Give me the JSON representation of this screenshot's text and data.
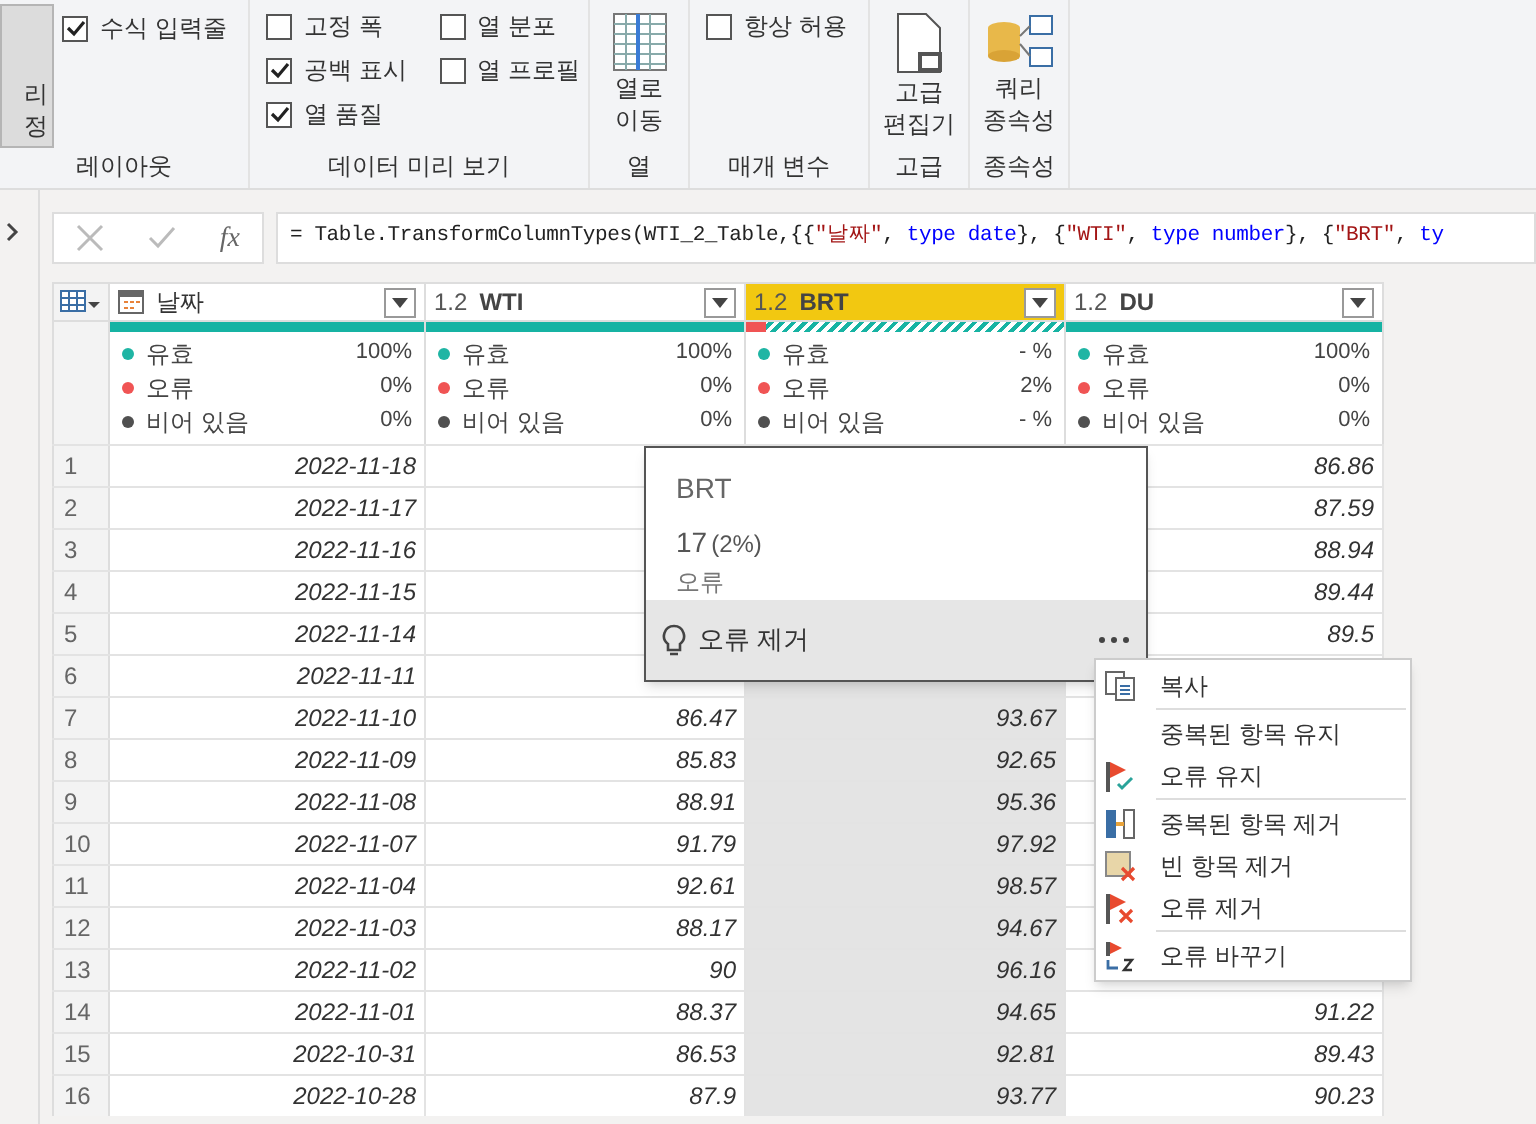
{
  "ribbon": {
    "query_settings": {
      "lines": [
        "리",
        "정"
      ],
      "selected": true
    },
    "groups": [
      {
        "label": "레이아웃",
        "kind": "checks",
        "checks": [
          {
            "label": "수식 입력줄",
            "checked": true
          }
        ]
      },
      {
        "label": "데이터 미리 보기",
        "kind": "checks",
        "checks": [
          {
            "label": "고정 폭",
            "checked": false
          },
          {
            "label": "열 분포",
            "checked": false
          },
          {
            "label": "공백 표시",
            "checked": true
          },
          {
            "label": "열 프로필",
            "checked": false
          },
          {
            "label": "열 품질",
            "checked": true
          }
        ]
      },
      {
        "label": "열",
        "kind": "move-button",
        "lines": [
          "열로",
          "이동"
        ]
      },
      {
        "label": "매개 변수",
        "kind": "checks",
        "checks": [
          {
            "label": "항상 허용",
            "checked": false
          }
        ]
      },
      {
        "label": "고급",
        "kind": "editor-button",
        "lines": [
          "고급",
          "편집기"
        ]
      },
      {
        "label": "종속성",
        "kind": "deps-button",
        "lines": [
          "쿼리",
          "종속성"
        ]
      }
    ]
  },
  "formula": {
    "fx_label": "fx",
    "segments": [
      {
        "kind": "plain",
        "text": "= Table.TransformColumnTypes(WTI_2_Table,{{"
      },
      {
        "kind": "string",
        "text": "\"날짜\""
      },
      {
        "kind": "plain",
        "text": ", "
      },
      {
        "kind": "keyword",
        "text": "type date"
      },
      {
        "kind": "plain",
        "text": "}, {"
      },
      {
        "kind": "string",
        "text": "\"WTI\""
      },
      {
        "kind": "plain",
        "text": ", "
      },
      {
        "kind": "keyword",
        "text": "type number"
      },
      {
        "kind": "plain",
        "text": "}, {"
      },
      {
        "kind": "string",
        "text": "\"BRT\""
      },
      {
        "kind": "plain",
        "text": ", "
      },
      {
        "kind": "keyword",
        "text": "ty"
      }
    ]
  },
  "table": {
    "columns": [
      {
        "kind": "date",
        "name": "날짜",
        "selected": false,
        "quality": {
          "validated": true
        },
        "stats": [
          {
            "label": "유효",
            "value": "100%",
            "color": "#1fb5a4"
          },
          {
            "label": "오류",
            "value": "0%",
            "color": "#f05454"
          },
          {
            "label": "비어 있음",
            "value": "0%",
            "color": "#505050"
          }
        ]
      },
      {
        "kind": "number",
        "type_label": "1.2",
        "name": "WTI",
        "selected": false,
        "quality": {
          "validated": true
        },
        "stats": [
          {
            "label": "유효",
            "value": "100%",
            "color": "#1fb5a4"
          },
          {
            "label": "오류",
            "value": "0%",
            "color": "#f05454"
          },
          {
            "label": "비어 있음",
            "value": "0%",
            "color": "#505050"
          }
        ]
      },
      {
        "kind": "number",
        "type_label": "1.2",
        "name": "BRT",
        "selected": true,
        "quality": {
          "validated": false,
          "error": {
            "level": 0.06
          }
        },
        "stats": [
          {
            "label": "유효",
            "value": "- %",
            "color": "#1fb5a4"
          },
          {
            "label": "오류",
            "value": "2%",
            "color": "#f05454"
          },
          {
            "label": "비어 있음",
            "value": "- %",
            "color": "#505050"
          }
        ]
      },
      {
        "kind": "number",
        "type_label": "1.2",
        "name": "DU",
        "selected": false,
        "quality": {
          "validated": true
        },
        "stats": [
          {
            "label": "유효",
            "value": "100%",
            "color": "#1fb5a4"
          },
          {
            "label": "오류",
            "value": "0%",
            "color": "#f05454"
          },
          {
            "label": "비어 있음",
            "value": "0%",
            "color": "#505050"
          }
        ]
      }
    ],
    "rows": [
      {
        "num": "1",
        "cells": [
          "2022-11-18",
          null,
          null,
          "86.86"
        ]
      },
      {
        "num": "2",
        "cells": [
          "2022-11-17",
          null,
          null,
          "87.59"
        ]
      },
      {
        "num": "3",
        "cells": [
          "2022-11-16",
          null,
          null,
          "88.94"
        ]
      },
      {
        "num": "4",
        "cells": [
          "2022-11-15",
          null,
          null,
          "89.44"
        ]
      },
      {
        "num": "5",
        "cells": [
          "2022-11-14",
          null,
          null,
          "89.5"
        ]
      },
      {
        "num": "6",
        "cells": [
          "2022-11-11",
          null,
          null,
          null
        ]
      },
      {
        "num": "7",
        "cells": [
          "2022-11-10",
          "86.47",
          "93.67",
          null
        ]
      },
      {
        "num": "8",
        "cells": [
          "2022-11-09",
          "85.83",
          "92.65",
          null
        ]
      },
      {
        "num": "9",
        "cells": [
          "2022-11-08",
          "88.91",
          "95.36",
          null
        ]
      },
      {
        "num": "10",
        "cells": [
          "2022-11-07",
          "91.79",
          "97.92",
          null
        ]
      },
      {
        "num": "11",
        "cells": [
          "2022-11-04",
          "92.61",
          "98.57",
          null
        ]
      },
      {
        "num": "12",
        "cells": [
          "2022-11-03",
          "88.17",
          "94.67",
          null
        ]
      },
      {
        "num": "13",
        "cells": [
          "2022-11-02",
          "90",
          "96.16",
          null
        ]
      },
      {
        "num": "14",
        "cells": [
          "2022-11-01",
          "88.37",
          "94.65",
          "91.22"
        ]
      },
      {
        "num": "15",
        "cells": [
          "2022-10-31",
          "86.53",
          "92.81",
          "89.43"
        ]
      },
      {
        "num": "16",
        "cells": [
          "2022-10-28",
          "87.9",
          "93.77",
          "90.23"
        ]
      }
    ]
  },
  "popup": {
    "title": "BRT",
    "count": "17",
    "percent": "(2%)",
    "label": "오류",
    "action": "오류 제거"
  },
  "menu": [
    {
      "kind": "copy",
      "label": "복사",
      "divider_before": false
    },
    {
      "kind": "none",
      "label": "중복된 항목 유지",
      "divider_before": true
    },
    {
      "kind": "keep-errors",
      "label": "오류 유지",
      "divider_before": false
    },
    {
      "kind": "remove-dup",
      "label": "중복된 항목 제거",
      "divider_before": true
    },
    {
      "kind": "remove-blank",
      "label": "빈 항목 제거",
      "divider_before": false
    },
    {
      "kind": "remove-errors",
      "label": "오류 제거",
      "divider_before": false
    },
    {
      "kind": "replace-errors",
      "label": "오류 바꾸기",
      "divider_before": true
    }
  ]
}
